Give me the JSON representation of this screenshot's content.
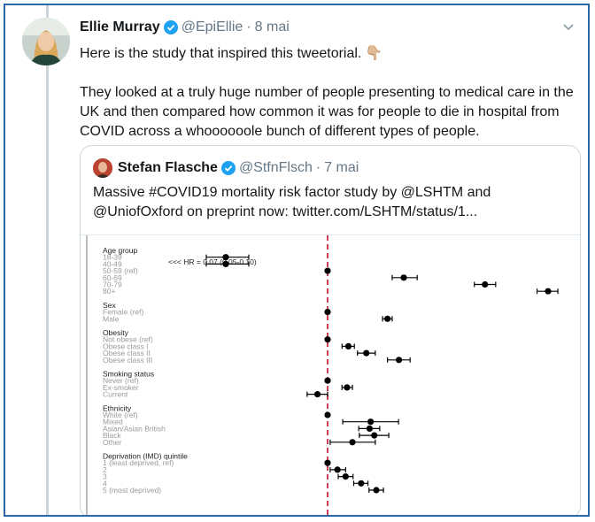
{
  "tweet": {
    "display_name": "Ellie Murray",
    "handle": "@EpiEllie",
    "time": "8 mai",
    "line1": "Here is the study that inspired this tweetorial.",
    "emoji": "👇🏼",
    "paragraph2": "They looked at a truly huge number of people presenting to medical care in the UK and then compared how common it was for people to die in hospital from COVID across a whoooooole bunch of different types of people."
  },
  "quoted": {
    "display_name": "Stefan Flasche",
    "handle": "@StfnFlsch",
    "time": "7 mai",
    "text": "Massive #COVID19 mortality risk factor study by @LSHTM and @UniofOxford on preprint now:  twitter.com/LSHTM/status/1..."
  },
  "figure": {
    "annotation": "<<< HR = 0.07 (0.05-0.10)",
    "groups": [
      {
        "title": "Age group",
        "levels": [
          "18-39",
          "40-49",
          "50-59 (ref)",
          "60-69",
          "70-79",
          "80+"
        ]
      },
      {
        "title": "Sex",
        "levels": [
          "Female (ref)",
          "Male"
        ]
      },
      {
        "title": "Obesity",
        "levels": [
          "Not obese (ref)",
          "Obese class I",
          "Obese class II",
          "Obese class III"
        ]
      },
      {
        "title": "Smoking status",
        "levels": [
          "Never (ref)",
          "Ex-smoker",
          "Current"
        ]
      },
      {
        "title": "Ethnicity",
        "levels": [
          "White (ref)",
          "Mixed",
          "Asian/Asian British",
          "Black",
          "Other"
        ]
      },
      {
        "title": "Deprivation (IMD) quintile",
        "levels": [
          "1 (least deprived, ref)",
          "2",
          "3",
          "4",
          "5 (most deprived)"
        ]
      }
    ]
  },
  "chart_data": {
    "type": "scatter",
    "description_type": "forest plot of hazard ratios with confidence intervals",
    "reference_line": 1,
    "annotation": "<<< HR = 0.07 (0.05-0.10)",
    "points": [
      {
        "label": "18-39",
        "hr": 0.07,
        "lo": 0.05,
        "hi": 0.1
      },
      {
        "label": "40-49",
        "hr": 0.3,
        "lo": 0.23,
        "hi": 0.38
      },
      {
        "label": "50-59 (ref)",
        "hr": 1,
        "lo": 1,
        "hi": 1
      },
      {
        "label": "60-69",
        "hr": 2.4,
        "lo": 2.1,
        "hi": 2.8
      },
      {
        "label": "70-79",
        "hr": 6.1,
        "lo": 5.4,
        "hi": 6.9
      },
      {
        "label": "80+",
        "hr": 12.6,
        "lo": 11.1,
        "hi": 14.1
      },
      {
        "label": "Female (ref)",
        "hr": 1,
        "lo": 1,
        "hi": 1
      },
      {
        "label": "Male",
        "hr": 1.99,
        "lo": 1.88,
        "hi": 2.1
      },
      {
        "label": "Not obese (ref)",
        "hr": 1,
        "lo": 1,
        "hi": 1
      },
      {
        "label": "Obese class I",
        "hr": 1.27,
        "lo": 1.18,
        "hi": 1.36
      },
      {
        "label": "Obese class II",
        "hr": 1.56,
        "lo": 1.41,
        "hi": 1.73
      },
      {
        "label": "Obese class III",
        "hr": 2.27,
        "lo": 1.99,
        "hi": 2.58
      },
      {
        "label": "Never (ref)",
        "hr": 1,
        "lo": 1,
        "hi": 1
      },
      {
        "label": "Ex-smoker",
        "hr": 1.25,
        "lo": 1.18,
        "hi": 1.33
      },
      {
        "label": "Current",
        "hr": 0.89,
        "lo": 0.79,
        "hi": 1.0
      },
      {
        "label": "White (ref)",
        "hr": 1,
        "lo": 1,
        "hi": 1
      },
      {
        "label": "Mixed",
        "hr": 1.64,
        "lo": 1.19,
        "hi": 2.26
      },
      {
        "label": "Asian/Asian British",
        "hr": 1.62,
        "lo": 1.43,
        "hi": 1.82
      },
      {
        "label": "Black",
        "hr": 1.71,
        "lo": 1.44,
        "hi": 2.02
      },
      {
        "label": "Other",
        "hr": 1.33,
        "lo": 1.03,
        "hi": 1.73
      },
      {
        "label": "1 (least deprived, ref)",
        "hr": 1,
        "lo": 1,
        "hi": 1
      },
      {
        "label": "2",
        "hr": 1.12,
        "lo": 1.03,
        "hi": 1.23
      },
      {
        "label": "3",
        "hr": 1.23,
        "lo": 1.13,
        "hi": 1.34
      },
      {
        "label": "4",
        "hr": 1.47,
        "lo": 1.35,
        "hi": 1.59
      },
      {
        "label": "5 (most deprived)",
        "hr": 1.75,
        "lo": 1.61,
        "hi": 1.9
      }
    ]
  },
  "colors": {
    "link": "#1da1f2",
    "secondary": "#657786",
    "verified": "#1da1f2",
    "frame": "#2b68a8",
    "ref_line": "#c0102a"
  },
  "icons": {
    "verified": "verified-badge-icon",
    "caret": "chevron-down-icon"
  }
}
